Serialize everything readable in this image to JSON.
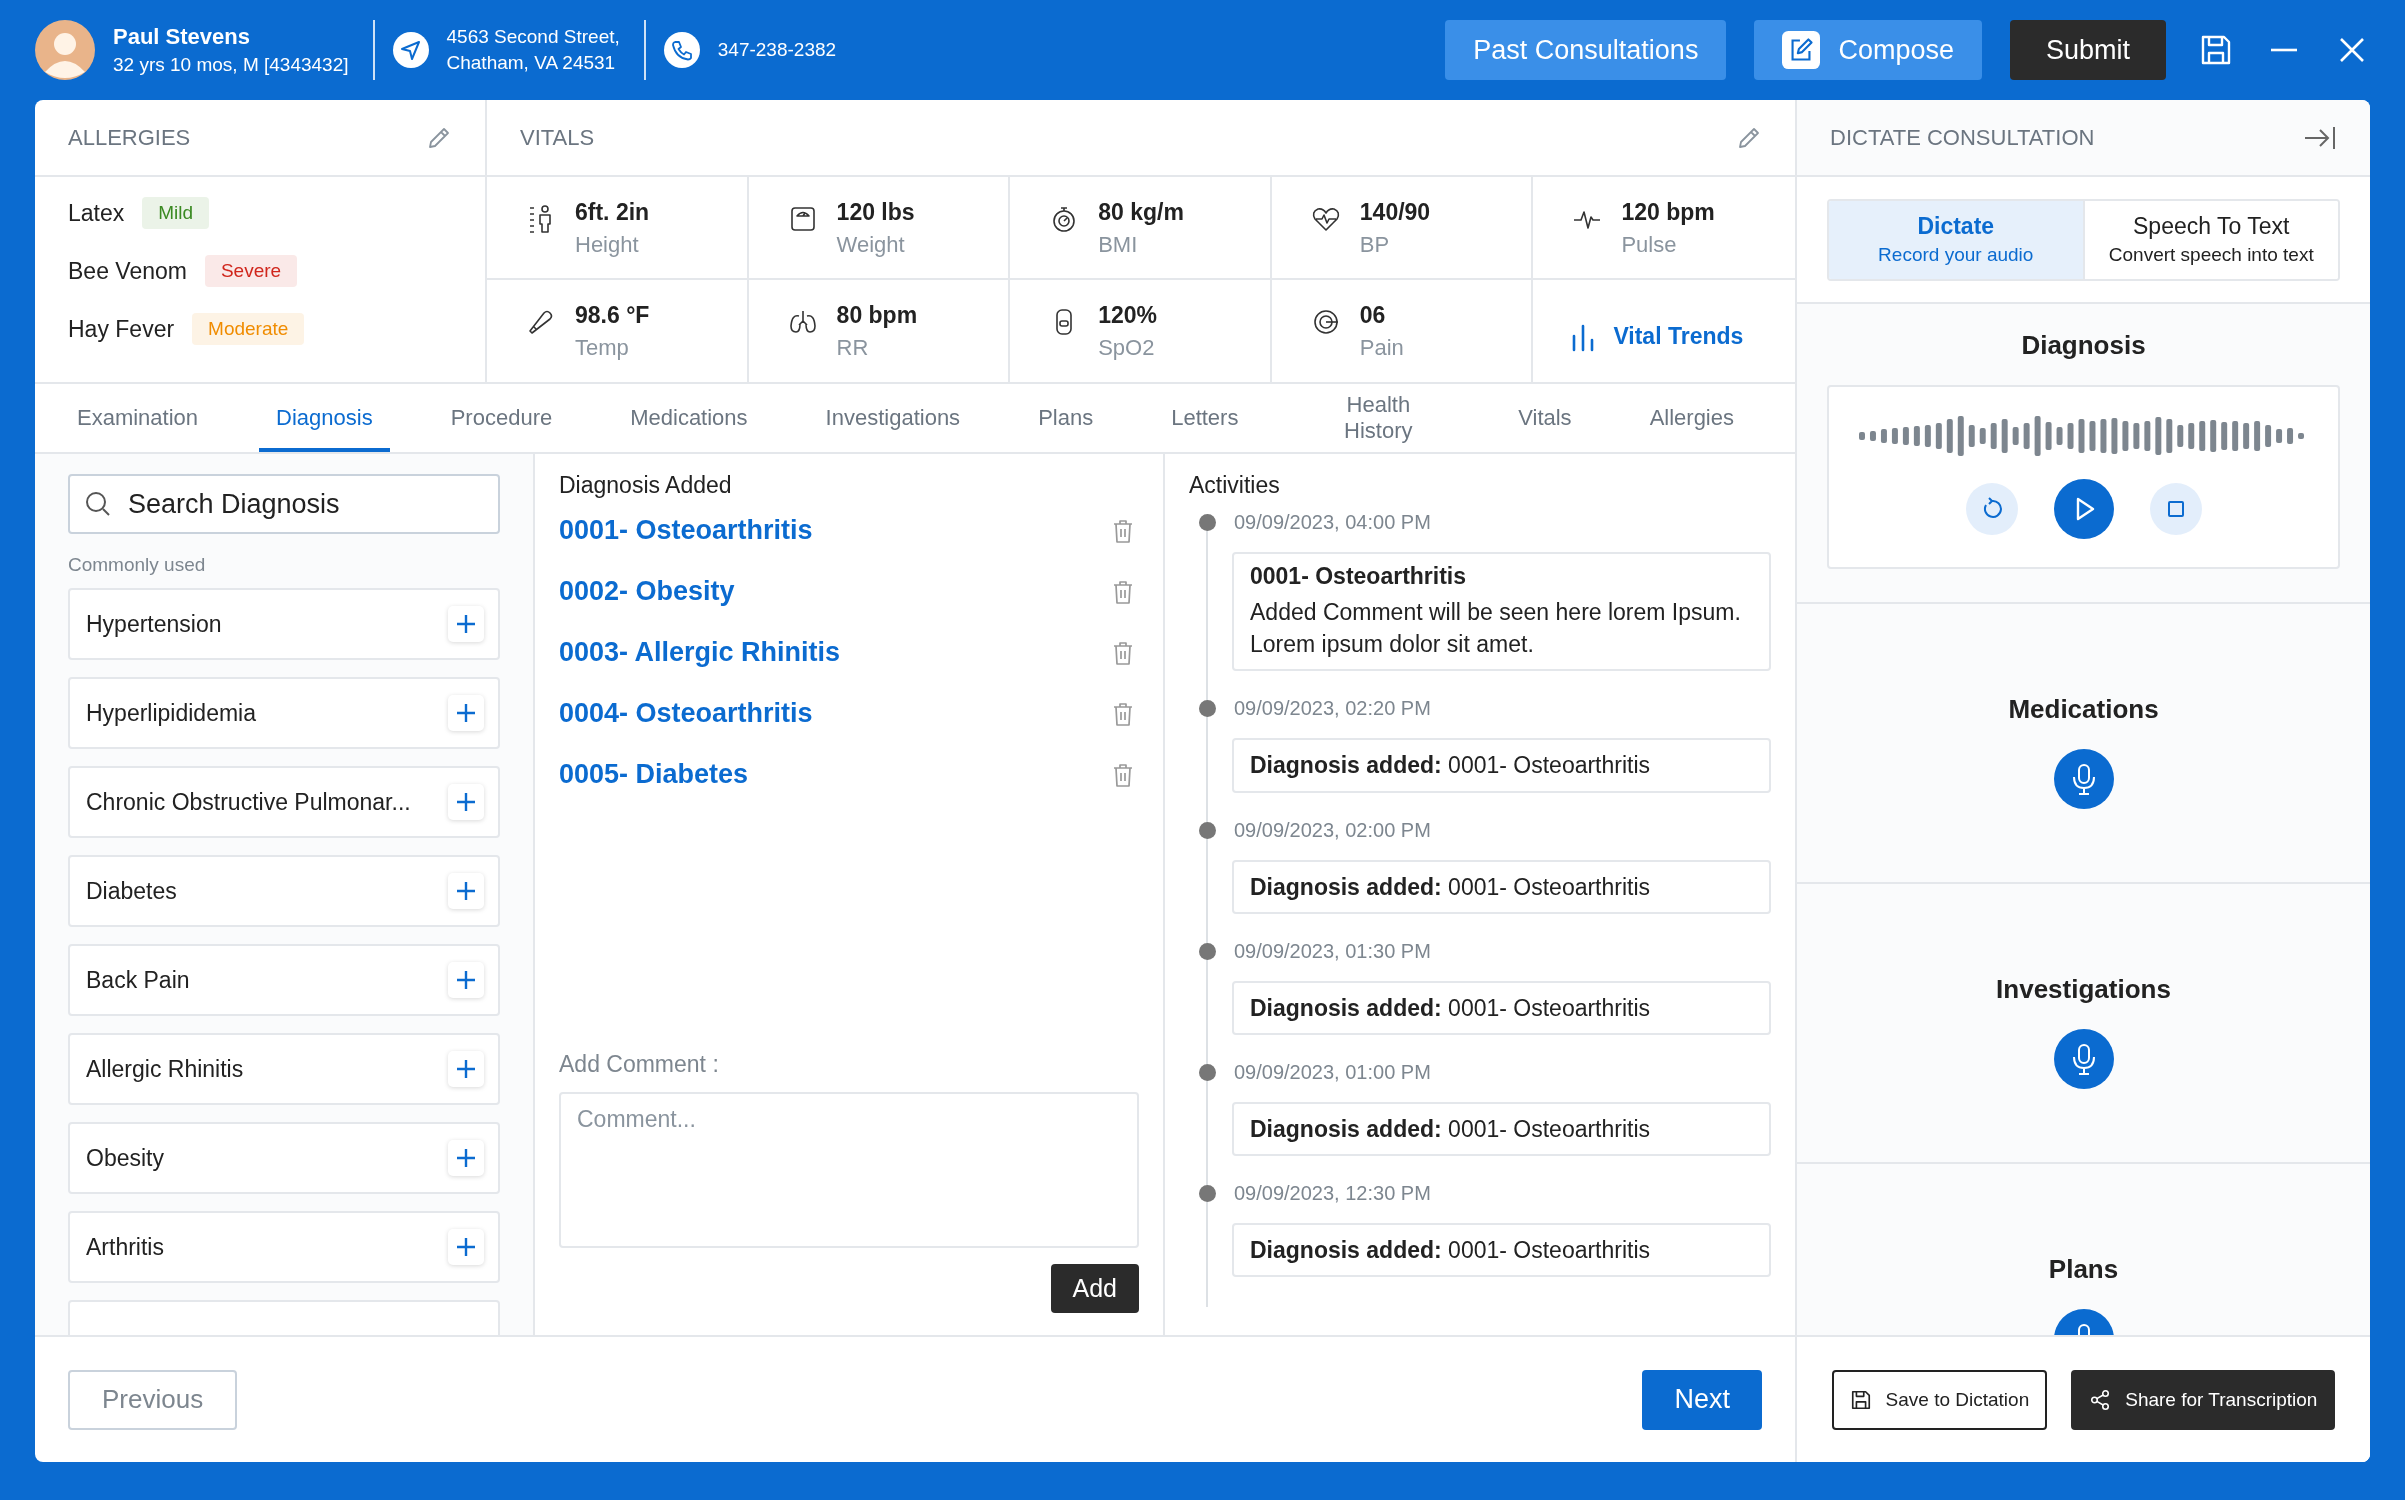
{
  "header": {
    "name": "Paul Stevens",
    "details": "32 yrs 10 mos, M [4343432]",
    "address": [
      "4563 Second Street,",
      "Chatham, VA 24531"
    ],
    "phone": "347-238-2382",
    "past": "Past Consultations",
    "compose": "Compose",
    "submit": "Submit"
  },
  "allergies": {
    "title": "ALLERGIES",
    "items": [
      {
        "name": "Latex",
        "severity": "Mild",
        "color": "#3a8a22"
      },
      {
        "name": "Bee Venom",
        "severity": "Severe",
        "color": "#d0261c"
      },
      {
        "name": "Hay Fever",
        "severity": "Moderate",
        "color": "#f08c00"
      }
    ]
  },
  "vitals": {
    "title": "VITALS",
    "items": [
      {
        "value": "6ft. 2in",
        "label": "Height"
      },
      {
        "value": "120 lbs",
        "label": "Weight"
      },
      {
        "value": "80 kg/m",
        "label": "BMI"
      },
      {
        "value": "140/90",
        "label": "BP"
      },
      {
        "value": "120 bpm",
        "label": "Pulse"
      },
      {
        "value": "98.6 °F",
        "label": "Temp"
      },
      {
        "value": "80 bpm",
        "label": "RR"
      },
      {
        "value": "120%",
        "label": "SpO2"
      },
      {
        "value": "06",
        "label": "Pain"
      }
    ],
    "trends": "Vital Trends"
  },
  "tabs": [
    {
      "label": "Examination",
      "selected": false
    },
    {
      "label": "Diagnosis",
      "selected": true
    },
    {
      "label": "Procedure",
      "selected": false
    },
    {
      "label": "Medications",
      "selected": false
    },
    {
      "label": "Investigations",
      "selected": false
    },
    {
      "label": "Plans",
      "selected": false
    },
    {
      "label": "Letters",
      "selected": false
    },
    {
      "label": "Health History",
      "selected": false
    },
    {
      "label": "Vitals",
      "selected": false
    },
    {
      "label": "Allergies",
      "selected": false
    }
  ],
  "search": {
    "placeholder": "Search Diagnosis"
  },
  "common": {
    "title": "Commonly used",
    "items": [
      "Hypertension",
      "Hyperlipididemia",
      "Chronic Obstructive Pulmonar...",
      "Diabetes",
      "Back Pain",
      "Allergic Rhinitis",
      "Obesity",
      "Arthritis"
    ]
  },
  "diagnoses": {
    "title": "Diagnosis Added",
    "items": [
      "0001- Osteoarthritis",
      "0002- Obesity",
      "0003- Allergic Rhinitis",
      "0004- Osteoarthritis",
      "0005- Diabetes"
    ]
  },
  "comment": {
    "label": "Add Comment :",
    "placeholder": "Comment...",
    "button": "Add"
  },
  "activities": {
    "title": "Activities",
    "items": [
      {
        "kind": "comment",
        "time": "09/09/2023, 04:00 PM",
        "title": "0001- Osteoarthritis",
        "text": "Added Comment will be seen here lorem Ipsum. Lorem ipsum dolor sit amet."
      },
      {
        "kind": "event",
        "time": "09/09/2023, 02:20 PM",
        "text": "**Diagnosis added:** 0001- Osteoarthritis"
      },
      {
        "kind": "event",
        "time": "09/09/2023, 02:00 PM",
        "text": "**Diagnosis added:** 0001- Osteoarthritis"
      },
      {
        "kind": "event",
        "time": "09/09/2023, 01:30 PM",
        "text": "**Diagnosis added:** 0001- Osteoarthritis"
      },
      {
        "kind": "event",
        "time": "09/09/2023, 01:00 PM",
        "text": "**Diagnosis added:** 0001- Osteoarthritis"
      },
      {
        "kind": "event",
        "time": "09/09/2023, 12:30 PM",
        "text": "**Diagnosis added:** 0001- Osteoarthritis"
      }
    ]
  },
  "dictate": {
    "title": "DICTATE CONSULTATION",
    "modes": [
      {
        "label": "Dictate",
        "hint": "Record your audio",
        "selected": true
      },
      {
        "label": "Speech To Text",
        "hint": "Convert speech into text",
        "selected": false
      }
    ],
    "sections": [
      {
        "kind": "player",
        "title": "Diagnosis"
      },
      {
        "kind": "mic",
        "title": "Medications"
      },
      {
        "kind": "mic",
        "title": "Investigations"
      },
      {
        "kind": "mic",
        "title": "Plans"
      }
    ],
    "save": "Save to Dictation",
    "share": "Share for Transcription"
  },
  "footer": {
    "previous": "Previous",
    "next": "Next"
  }
}
